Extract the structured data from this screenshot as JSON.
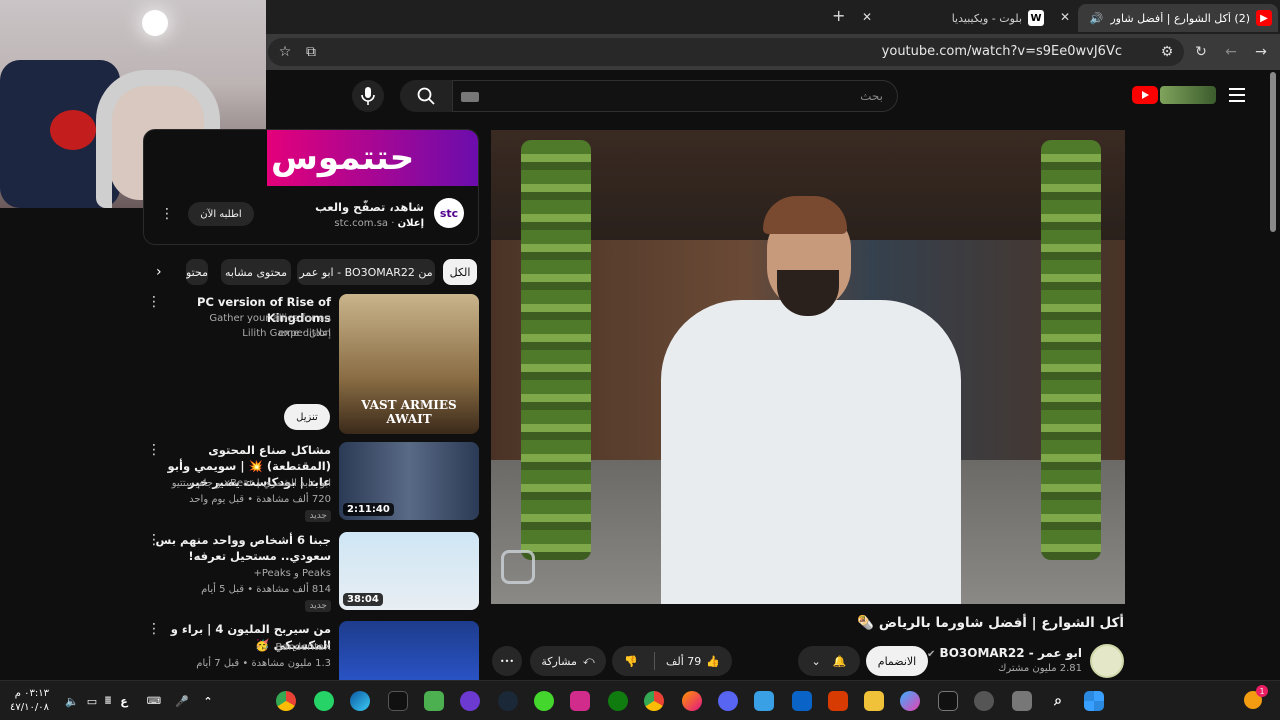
{
  "browser": {
    "tabs": [
      {
        "title": "(2) أكل الشوارع | أفضل شاور",
        "active": true
      },
      {
        "title": "بلوت - ويكيبيديا",
        "active": false
      }
    ],
    "new_tab": "+",
    "close": "✕",
    "url": "youtube.com/watch?v=s9Ee0wvJ6Vc"
  },
  "youtube": {
    "search_placeholder": "بحث",
    "logo_alt": "YouTube"
  },
  "ad": {
    "banner_text": "حتتموس",
    "title": "شاهد، تصفّح والعب",
    "sponsor_label": "إعلان",
    "domain": "stc.com.sa",
    "logo_text": "stc",
    "cta": "اطلبه الآن"
  },
  "chips": [
    "الكل",
    "من BO3OMAR22 - ابو عمر",
    "محتوى مشابه",
    "محتو"
  ],
  "recommendations": [
    {
      "title": "PC version of Rise of Kingdoms",
      "line2": "Gather your allies for an expedition",
      "line3": "Lilith Game · إعلان",
      "thumb_caption": "VAST ARMIES AWAIT",
      "cta": "تنزيل"
    },
    {
      "title": "مشاكل صناع المحتوى (المقتطعة) 💥 | سويمي وأبو عابد | بودكاست يصير خير",
      "channel": "ابو عابد الشمري | xBear و جام ستتيو",
      "meta": "720 ألف مشاهدة • قبل يوم واحد",
      "badge": "جديد",
      "duration": "2:11:40"
    },
    {
      "title": "جبنا 6 أشخاص وواحد منهم بس سعودي.. مستحيل تعرفه!",
      "channel": "Peaks و Peaks+",
      "meta": "814 ألف مشاهدة • قبل 5 أيام",
      "badge": "جديد",
      "duration": "38:04"
    },
    {
      "title": "من سيربح المليون 4 | براء و المكسيكي 🥳",
      "channel": "BanderitaX",
      "meta": "1.3 مليون مشاهدة • قبل 7 أيام"
    }
  ],
  "video": {
    "title": "أكل الشوارع | أفضل شاورما بالرياض 🌯",
    "channel": "ابو عمر - BO3OMAR22",
    "subscribers": "2.81 مليون مشترك",
    "join": "الانضمام",
    "likes": "79 ألف",
    "share": "مشاركة",
    "more": "•••"
  },
  "taskbar": {
    "time": "٠٣:١٣ م",
    "date": "٤٧/١٠/٠٨",
    "lang": "ع",
    "notification_count": "1"
  },
  "colors": {
    "bg": "#0f0f0f",
    "yt_red": "#ff0000",
    "stc_purple": "#4f008c"
  }
}
